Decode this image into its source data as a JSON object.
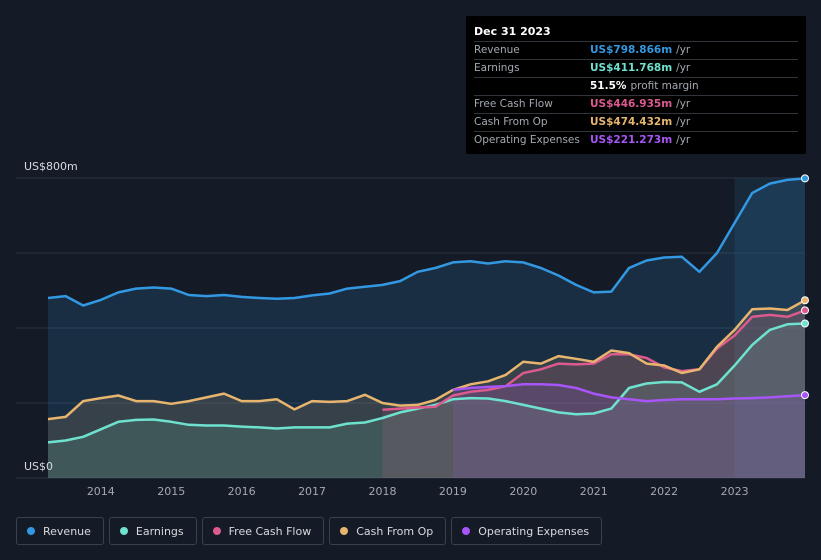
{
  "tooltip": {
    "date": "Dec 31 2023",
    "rows": [
      {
        "label": "Revenue",
        "value": "US$798.866m",
        "unit": "/yr",
        "color": "#3398e2"
      },
      {
        "label": "Earnings",
        "value": "US$411.768m",
        "unit": "/yr",
        "color": "#6ee2cf"
      },
      {
        "label": "",
        "value": "51.5%",
        "unit": "profit margin",
        "color": "#ffffff"
      },
      {
        "label": "Free Cash Flow",
        "value": "US$446.935m",
        "unit": "/yr",
        "color": "#dc5a8e"
      },
      {
        "label": "Cash From Op",
        "value": "US$474.432m",
        "unit": "/yr",
        "color": "#e8b56e"
      },
      {
        "label": "Operating Expenses",
        "value": "US$221.273m",
        "unit": "/yr",
        "color": "#a855f7"
      }
    ]
  },
  "legend": [
    {
      "label": "Revenue",
      "color": "#3398e2"
    },
    {
      "label": "Earnings",
      "color": "#6ee2cf"
    },
    {
      "label": "Free Cash Flow",
      "color": "#dc5a8e"
    },
    {
      "label": "Cash From Op",
      "color": "#e8b56e"
    },
    {
      "label": "Operating Expenses",
      "color": "#a855f7"
    }
  ],
  "chart_data": {
    "type": "area",
    "y_top_label": "US$800m",
    "y_bottom_label": "US$0",
    "ylim": [
      0,
      800
    ],
    "xlim": [
      2013.25,
      2024.0
    ],
    "x_ticks": [
      "2014",
      "2015",
      "2016",
      "2017",
      "2018",
      "2019",
      "2020",
      "2021",
      "2022",
      "2023"
    ],
    "grid": true,
    "series": [
      {
        "name": "Revenue",
        "color": "#3398e2",
        "points": [
          [
            2013.25,
            480
          ],
          [
            2013.5,
            485
          ],
          [
            2013.75,
            460
          ],
          [
            2014.0,
            475
          ],
          [
            2014.25,
            495
          ],
          [
            2014.5,
            505
          ],
          [
            2014.75,
            508
          ],
          [
            2015.0,
            505
          ],
          [
            2015.25,
            488
          ],
          [
            2015.5,
            485
          ],
          [
            2015.75,
            488
          ],
          [
            2016.0,
            483
          ],
          [
            2016.25,
            480
          ],
          [
            2016.5,
            478
          ],
          [
            2016.75,
            480
          ],
          [
            2017.0,
            487
          ],
          [
            2017.25,
            492
          ],
          [
            2017.5,
            505
          ],
          [
            2017.75,
            510
          ],
          [
            2018.0,
            515
          ],
          [
            2018.25,
            525
          ],
          [
            2018.5,
            550
          ],
          [
            2018.75,
            560
          ],
          [
            2019.0,
            575
          ],
          [
            2019.25,
            578
          ],
          [
            2019.5,
            572
          ],
          [
            2019.75,
            578
          ],
          [
            2020.0,
            575
          ],
          [
            2020.25,
            560
          ],
          [
            2020.5,
            540
          ],
          [
            2020.75,
            515
          ],
          [
            2021.0,
            495
          ],
          [
            2021.25,
            497
          ],
          [
            2021.5,
            560
          ],
          [
            2021.75,
            580
          ],
          [
            2022.0,
            588
          ],
          [
            2022.25,
            590
          ],
          [
            2022.5,
            550
          ],
          [
            2022.75,
            600
          ],
          [
            2023.0,
            680
          ],
          [
            2023.25,
            760
          ],
          [
            2023.5,
            785
          ],
          [
            2023.75,
            795
          ],
          [
            2024.0,
            799
          ]
        ]
      },
      {
        "name": "Earnings",
        "color": "#6ee2cf",
        "points": [
          [
            2013.25,
            95
          ],
          [
            2013.5,
            100
          ],
          [
            2013.75,
            110
          ],
          [
            2014.0,
            130
          ],
          [
            2014.25,
            150
          ],
          [
            2014.5,
            155
          ],
          [
            2014.75,
            156
          ],
          [
            2015.0,
            150
          ],
          [
            2015.25,
            142
          ],
          [
            2015.5,
            140
          ],
          [
            2015.75,
            140
          ],
          [
            2016.0,
            137
          ],
          [
            2016.25,
            135
          ],
          [
            2016.5,
            132
          ],
          [
            2016.75,
            135
          ],
          [
            2017.0,
            135
          ],
          [
            2017.25,
            135
          ],
          [
            2017.5,
            145
          ],
          [
            2017.75,
            148
          ],
          [
            2018.0,
            160
          ],
          [
            2018.25,
            175
          ],
          [
            2018.5,
            185
          ],
          [
            2018.75,
            195
          ],
          [
            2019.0,
            210
          ],
          [
            2019.25,
            213
          ],
          [
            2019.5,
            212
          ],
          [
            2019.75,
            205
          ],
          [
            2020.0,
            195
          ],
          [
            2020.25,
            185
          ],
          [
            2020.5,
            175
          ],
          [
            2020.75,
            170
          ],
          [
            2021.0,
            172
          ],
          [
            2021.25,
            185
          ],
          [
            2021.5,
            240
          ],
          [
            2021.75,
            252
          ],
          [
            2022.0,
            256
          ],
          [
            2022.25,
            255
          ],
          [
            2022.5,
            230
          ],
          [
            2022.75,
            250
          ],
          [
            2023.0,
            300
          ],
          [
            2023.25,
            355
          ],
          [
            2023.5,
            395
          ],
          [
            2023.75,
            410
          ],
          [
            2024.0,
            412
          ]
        ]
      },
      {
        "name": "Free Cash Flow",
        "color": "#dc5a8e",
        "points": [
          [
            2018.0,
            182
          ],
          [
            2018.25,
            185
          ],
          [
            2018.5,
            188
          ],
          [
            2018.75,
            190
          ],
          [
            2019.0,
            220
          ],
          [
            2019.25,
            230
          ],
          [
            2019.5,
            235
          ],
          [
            2019.75,
            245
          ],
          [
            2020.0,
            280
          ],
          [
            2020.25,
            290
          ],
          [
            2020.5,
            305
          ],
          [
            2020.75,
            303
          ],
          [
            2021.0,
            305
          ],
          [
            2021.25,
            330
          ],
          [
            2021.5,
            330
          ],
          [
            2021.75,
            320
          ],
          [
            2022.0,
            295
          ],
          [
            2022.25,
            285
          ],
          [
            2022.5,
            290
          ],
          [
            2022.75,
            345
          ],
          [
            2023.0,
            380
          ],
          [
            2023.25,
            430
          ],
          [
            2023.5,
            435
          ],
          [
            2023.75,
            430
          ],
          [
            2024.0,
            447
          ]
        ]
      },
      {
        "name": "Cash From Op",
        "color": "#e8b56e",
        "points": [
          [
            2013.25,
            157
          ],
          [
            2013.5,
            163
          ],
          [
            2013.75,
            205
          ],
          [
            2014.0,
            213
          ],
          [
            2014.25,
            220
          ],
          [
            2014.5,
            205
          ],
          [
            2014.75,
            205
          ],
          [
            2015.0,
            198
          ],
          [
            2015.25,
            205
          ],
          [
            2015.5,
            215
          ],
          [
            2015.75,
            225
          ],
          [
            2016.0,
            205
          ],
          [
            2016.25,
            205
          ],
          [
            2016.5,
            210
          ],
          [
            2016.75,
            183
          ],
          [
            2017.0,
            205
          ],
          [
            2017.25,
            203
          ],
          [
            2017.5,
            205
          ],
          [
            2017.75,
            222
          ],
          [
            2018.0,
            200
          ],
          [
            2018.25,
            193
          ],
          [
            2018.5,
            195
          ],
          [
            2018.75,
            208
          ],
          [
            2019.0,
            235
          ],
          [
            2019.25,
            250
          ],
          [
            2019.5,
            258
          ],
          [
            2019.75,
            275
          ],
          [
            2020.0,
            310
          ],
          [
            2020.25,
            305
          ],
          [
            2020.5,
            325
          ],
          [
            2020.75,
            318
          ],
          [
            2021.0,
            310
          ],
          [
            2021.25,
            340
          ],
          [
            2021.5,
            333
          ],
          [
            2021.75,
            305
          ],
          [
            2022.0,
            300
          ],
          [
            2022.25,
            280
          ],
          [
            2022.5,
            290
          ],
          [
            2022.75,
            350
          ],
          [
            2023.0,
            395
          ],
          [
            2023.25,
            450
          ],
          [
            2023.5,
            452
          ],
          [
            2023.75,
            448
          ],
          [
            2024.0,
            474
          ]
        ]
      },
      {
        "name": "Operating Expenses",
        "color": "#a855f7",
        "points": [
          [
            2019.0,
            235
          ],
          [
            2019.25,
            240
          ],
          [
            2019.5,
            243
          ],
          [
            2019.75,
            245
          ],
          [
            2020.0,
            250
          ],
          [
            2020.25,
            250
          ],
          [
            2020.5,
            248
          ],
          [
            2020.75,
            240
          ],
          [
            2021.0,
            225
          ],
          [
            2021.25,
            215
          ],
          [
            2021.5,
            210
          ],
          [
            2021.75,
            205
          ],
          [
            2022.0,
            208
          ],
          [
            2022.25,
            210
          ],
          [
            2022.5,
            210
          ],
          [
            2022.75,
            210
          ],
          [
            2023.0,
            212
          ],
          [
            2023.25,
            213
          ],
          [
            2023.5,
            215
          ],
          [
            2023.75,
            218
          ],
          [
            2024.0,
            221
          ]
        ]
      }
    ]
  }
}
